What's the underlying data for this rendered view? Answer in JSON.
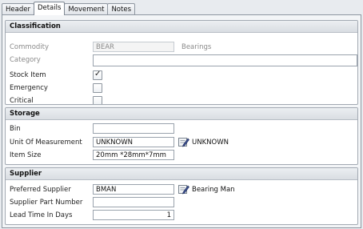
{
  "tabs": [
    {
      "label": "Header"
    },
    {
      "label": "Details"
    },
    {
      "label": "Movement"
    },
    {
      "label": "Notes"
    }
  ],
  "classification": {
    "title": "Classification",
    "commodity": {
      "label": "Commodity",
      "value": "BEAR",
      "description": "Bearings"
    },
    "category": {
      "label": "Category",
      "value": ""
    },
    "stock_item": {
      "label": "Stock Item",
      "checked": true,
      "tick": "✓"
    },
    "emergency": {
      "label": "Emergency",
      "checked": false
    },
    "critical": {
      "label": "Critical",
      "checked": false
    }
  },
  "storage": {
    "title": "Storage",
    "bin": {
      "label": "Bin",
      "value": ""
    },
    "unit_of_measurement": {
      "label": "Unit Of Measurement",
      "value": "UNKNOWN",
      "description": "UNKNOWN"
    },
    "item_size": {
      "label": "Item Size",
      "value": "20mm *28mm*7mm"
    }
  },
  "supplier": {
    "title": "Supplier",
    "preferred_supplier": {
      "label": "Preferred Supplier",
      "value": "BMAN",
      "description": "Bearing Man"
    },
    "supplier_part_number": {
      "label": "Supplier Part Number",
      "value": ""
    },
    "lead_time": {
      "label": "Lead Time In Days",
      "value": "1"
    }
  },
  "icons": {
    "lookup": "lookup-pencil-icon"
  },
  "colors": {
    "group_header": "#dde1e6",
    "active_tab": "#ffffff",
    "border": "#9aa3ad"
  }
}
